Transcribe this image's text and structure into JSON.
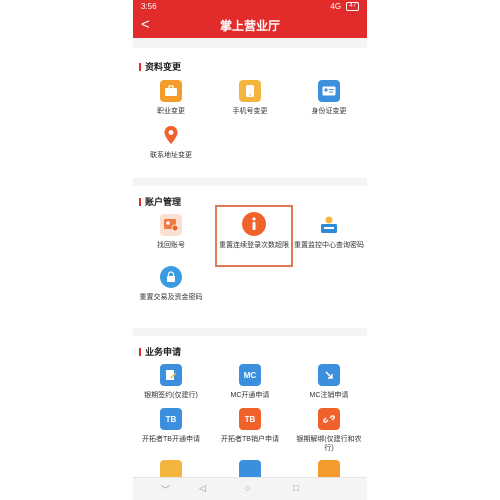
{
  "status_bar": {
    "time": "3:56",
    "signal": "4G",
    "battery": "47"
  },
  "header": {
    "back_symbol": "<",
    "title": "掌上营业厅"
  },
  "sections": {
    "info_change": {
      "title": "资料变更",
      "items": [
        {
          "label": "职业变更",
          "icon": "briefcase-icon",
          "color": "#f39b2b"
        },
        {
          "label": "手机号变更",
          "icon": "phone-icon",
          "color": "#f3b53d"
        },
        {
          "label": "身份证变更",
          "icon": "id-card-icon",
          "color": "#3b8fdc"
        },
        {
          "label": "联系地址变更",
          "icon": "location-pin-icon",
          "color": "#f0612b"
        }
      ]
    },
    "account": {
      "title": "账户管理",
      "items": [
        {
          "label": "找回账号",
          "icon": "account-recover-icon",
          "color": "#f07a44"
        },
        {
          "label": "重置连续登录次数超限",
          "icon": "info-icon",
          "color": "#f0612b"
        },
        {
          "label": "重置监控中心查询密码",
          "icon": "monitor-password-icon",
          "color": "#2f8ad8"
        },
        {
          "label": "重置交易及资金密码",
          "icon": "lock-icon",
          "color": "#3b9be0"
        }
      ]
    },
    "business": {
      "title": "业务申请",
      "items": [
        {
          "label": "银期签约(仅建行)",
          "icon": "sign-document-icon",
          "color": "#3b8fdc"
        },
        {
          "label": "MC开通申请",
          "icon": "mc-open-icon",
          "text": "MC",
          "color": "#3b8fdc"
        },
        {
          "label": "MC注销申请",
          "icon": "mc-cancel-icon",
          "color": "#3b8fdc"
        },
        {
          "label": "开拓者TB开通申请",
          "icon": "tb-open-icon",
          "text": "TB",
          "color": "#3b8fdc"
        },
        {
          "label": "开拓者TB销户申请",
          "icon": "tb-close-icon",
          "text": "TB",
          "color": "#f0612b"
        },
        {
          "label": "银期解绑(仅建行和农行)",
          "icon": "unlink-icon",
          "color": "#f0612b"
        },
        {
          "label": "",
          "icon": "partial-icon-1",
          "color": "#f3b53d"
        },
        {
          "label": "",
          "icon": "partial-icon-2",
          "color": "#3b8fdc"
        },
        {
          "label": "",
          "icon": "partial-icon-3",
          "color": "#f39b2b"
        }
      ]
    }
  },
  "bottom_nav": {
    "down": "﹀",
    "back": "◁",
    "home": "○",
    "recent": "□"
  }
}
